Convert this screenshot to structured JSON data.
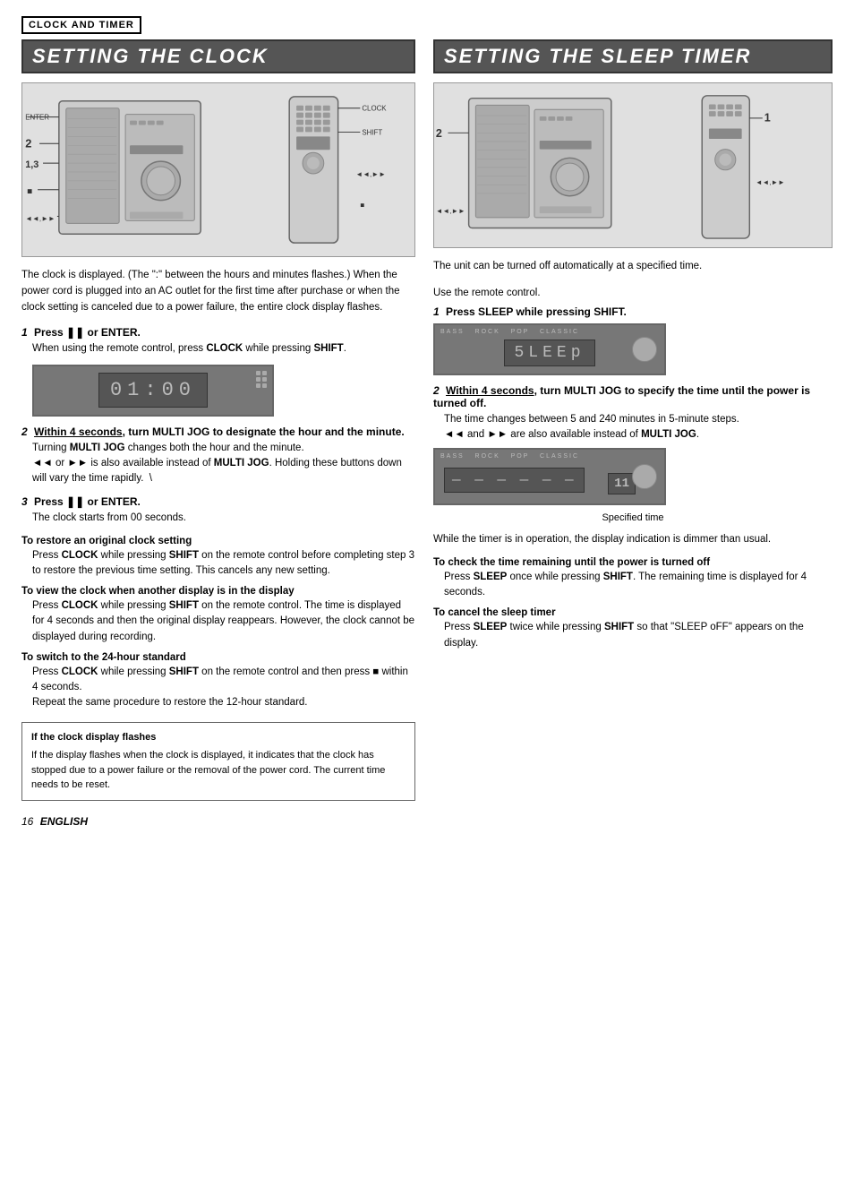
{
  "header": {
    "title": "CLOCK AND TIMER"
  },
  "left_section": {
    "heading": "SETTING THE CLOCK",
    "intro": "The clock is displayed. (The \":\" between the hours and minutes flashes.) When the power cord is plugged into an AC outlet for the first time after purchase or when the clock setting is canceled due to a power failure, the entire clock display flashes.",
    "steps": [
      {
        "num": "1",
        "title": "Press ❚❚ or ENTER.",
        "body": "When using the remote control, press CLOCK while pressing SHIFT."
      },
      {
        "num": "2",
        "title": "Within 4 seconds, turn MULTI JOG to designate the hour and the minute.",
        "body": "Turning MULTI JOG changes both the hour and the minute. ◄◄ or ►► is also available instead of MULTI JOG. Holding these buttons down will vary the time rapidly."
      },
      {
        "num": "3",
        "title": "Press ❚❚ or ENTER.",
        "body": "The clock starts from 00 seconds."
      }
    ],
    "sub_sections": [
      {
        "title": "To restore an original clock setting",
        "body": "Press CLOCK while pressing SHIFT on the remote control before completing step 3 to restore the previous time setting. This cancels any new setting."
      },
      {
        "title": "To view the clock when another display is in the display",
        "body": "Press CLOCK while pressing SHIFT on the remote control. The time is displayed for 4 seconds and then the original display reappears. However, the clock cannot be displayed during recording."
      },
      {
        "title": "To switch to the 24-hour standard",
        "body": "Press CLOCK while pressing SHIFT on the remote control and then press ■ within 4 seconds.\nRepeat the same procedure to restore the 12-hour standard."
      }
    ],
    "info_box": {
      "title": "If the clock display flashes",
      "body": "If the display flashes when the clock is displayed, it indicates that the clock has stopped due to a power failure or the removal of the power cord. The current time needs to be reset."
    },
    "display_text": "01:00",
    "diagram_labels": [
      "ENTER",
      "2",
      "1,3",
      "■",
      "◄◄,►►",
      "CLOCK",
      "SHIFT",
      "◄◄,►►",
      "■"
    ]
  },
  "right_section": {
    "heading": "SETTING THE SLEEP TIMER",
    "intro": "The unit can be turned off automatically at a specified time.",
    "use_remote": "Use the remote control.",
    "steps": [
      {
        "num": "1",
        "title": "Press SLEEP while pressing SHIFT.",
        "body": ""
      },
      {
        "num": "2",
        "title": "Within 4 seconds, turn MULTI JOG to specify the time until the power is turned off.",
        "body": "The time changes between 5 and 240 minutes in 5-minute steps.\n◄◄ and ►► are also available instead of MULTI JOG."
      }
    ],
    "sub_sections": [
      {
        "title": "To check the time remaining until the power is turned off",
        "body": "Press SLEEP once while pressing SHIFT. The remaining time is displayed for 4 seconds."
      },
      {
        "title": "To cancel the sleep timer",
        "body": "Press SLEEP twice while pressing SHIFT so that \"SLEEP oFF\" appears on the display."
      }
    ],
    "timer_note": "While the timer is in operation, the display indication is dimmer than usual.",
    "specified_label": "Specified time",
    "display1_text": "5LEEp",
    "display2_text": "11",
    "diagram_labels": [
      "2",
      "1",
      "◄◄,►►",
      "◄◄,►►"
    ]
  },
  "footer": {
    "page_num": "16",
    "lang": "ENGLISH"
  }
}
